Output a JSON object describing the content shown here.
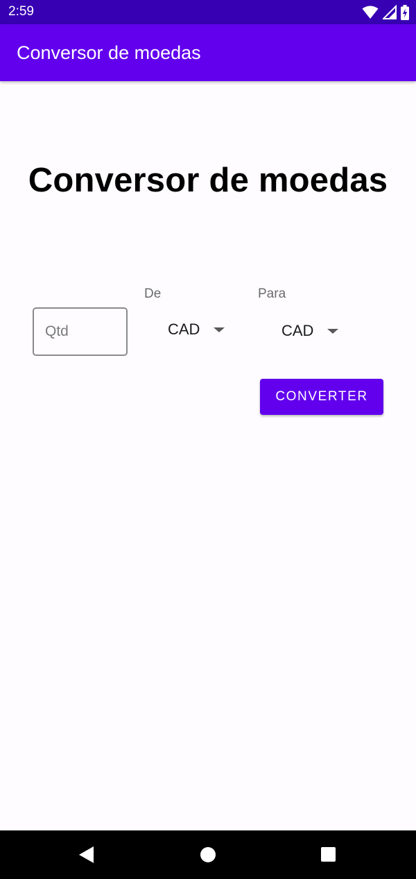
{
  "status_bar": {
    "time": "2:59",
    "icons": [
      "wifi-icon",
      "signal-icon",
      "battery-charging-icon"
    ]
  },
  "app_bar": {
    "title": "Conversor de moedas",
    "color": "#6200ee"
  },
  "main": {
    "title": "Conversor de moedas",
    "quantity_input": {
      "value": "",
      "placeholder": "Qtd"
    },
    "from": {
      "label": "De",
      "selected": "CAD"
    },
    "to": {
      "label": "Para",
      "selected": "CAD"
    },
    "convert_button": {
      "label": "CONVERTER"
    }
  },
  "nav_bar": {
    "icons": [
      "back-icon",
      "home-icon",
      "recents-icon"
    ]
  },
  "colors": {
    "status_bar": "#3700b3",
    "primary": "#6200ee",
    "background": "#fefcff"
  }
}
